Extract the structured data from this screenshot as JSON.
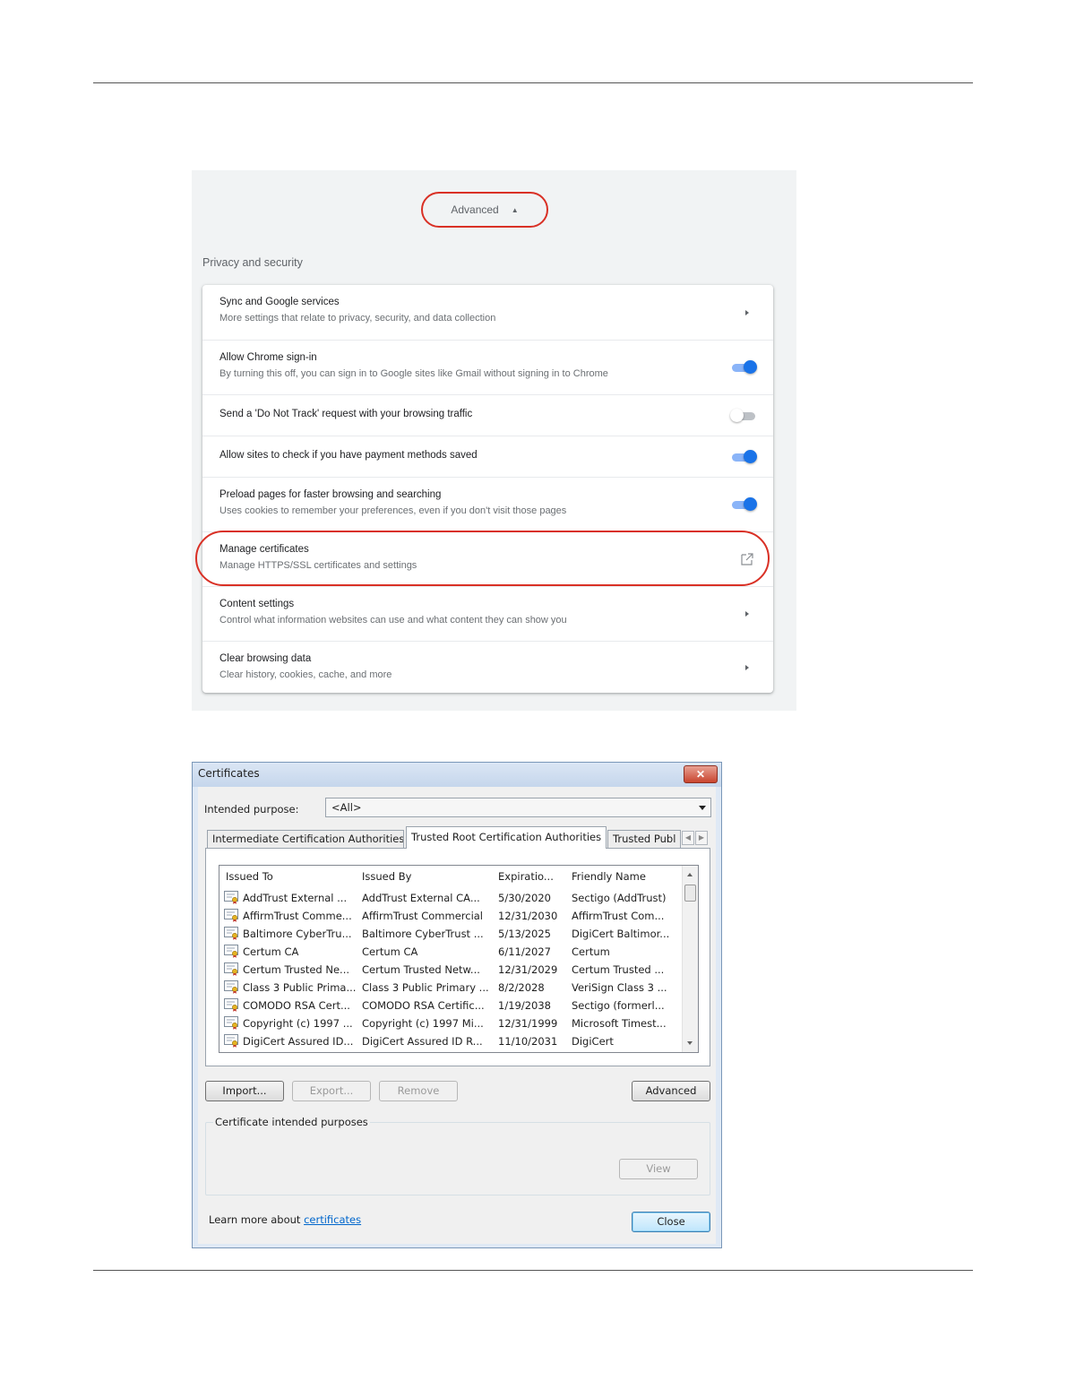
{
  "settings": {
    "advanced_label": "Advanced",
    "section_title": "Privacy and security",
    "rows": [
      {
        "title": "Sync and Google services",
        "subtitle": "More settings that relate to privacy, security, and data collection",
        "control": "arrow"
      },
      {
        "title": "Allow Chrome sign-in",
        "subtitle": "By turning this off, you can sign in to Google sites like Gmail without signing in to Chrome",
        "control": "toggle-on"
      },
      {
        "title": "Send a 'Do Not Track' request with your browsing traffic",
        "subtitle": "",
        "control": "toggle-off"
      },
      {
        "title": "Allow sites to check if you have payment methods saved",
        "subtitle": "",
        "control": "toggle-on"
      },
      {
        "title": "Preload pages for faster browsing and searching",
        "subtitle": "Uses cookies to remember your preferences, even if you don't visit those pages",
        "control": "toggle-on"
      },
      {
        "title": "Manage certificates",
        "subtitle": "Manage HTTPS/SSL certificates and settings",
        "control": "external-link"
      },
      {
        "title": "Content settings",
        "subtitle": "Control what information websites can use and what content they can show you",
        "control": "arrow"
      },
      {
        "title": "Clear browsing data",
        "subtitle": "Clear history, cookies, cache, and more",
        "control": "arrow"
      }
    ],
    "colors": {
      "highlight": "#d93025",
      "toggle_on": "#1a73e8"
    }
  },
  "dialog": {
    "title": "Certificates",
    "close_glyph": "✕",
    "intended_purpose_label": "Intended purpose:",
    "intended_purpose_value": "<All>",
    "tabs": {
      "intermediate": "Intermediate Certification Authorities",
      "trusted_root": "Trusted Root Certification Authorities",
      "trusted_publishers": "Trusted Publ"
    },
    "columns": [
      "Issued To",
      "Issued By",
      "Expiratio...",
      "Friendly Name"
    ],
    "rows": [
      [
        "AddTrust External ...",
        "AddTrust External CA...",
        "5/30/2020",
        "Sectigo (AddTrust)"
      ],
      [
        "AffirmTrust Comme...",
        "AffirmTrust Commercial",
        "12/31/2030",
        "AffirmTrust Com..."
      ],
      [
        "Baltimore CyberTru...",
        "Baltimore CyberTrust ...",
        "5/13/2025",
        "DigiCert Baltimor..."
      ],
      [
        "Certum CA",
        "Certum CA",
        "6/11/2027",
        "Certum"
      ],
      [
        "Certum Trusted Ne...",
        "Certum Trusted Netw...",
        "12/31/2029",
        "Certum Trusted ..."
      ],
      [
        "Class 3 Public Prima...",
        "Class 3 Public Primary ...",
        "8/2/2028",
        "VeriSign Class 3 ..."
      ],
      [
        "COMODO RSA Cert...",
        "COMODO RSA Certific...",
        "1/19/2038",
        "Sectigo (formerl..."
      ],
      [
        "Copyright (c) 1997 ...",
        "Copyright (c) 1997 Mi...",
        "12/31/1999",
        "Microsoft Timest..."
      ],
      [
        "DigiCert Assured ID...",
        "DigiCert Assured ID R...",
        "11/10/2031",
        "DigiCert"
      ]
    ],
    "buttons": {
      "import": "Import...",
      "export": "Export...",
      "remove": "Remove",
      "advanced": "Advanced",
      "view": "View",
      "close": "Close"
    },
    "group_label": "Certificate intended purposes",
    "learn_more_prefix": "Learn more about ",
    "learn_more_link": "certificates"
  }
}
